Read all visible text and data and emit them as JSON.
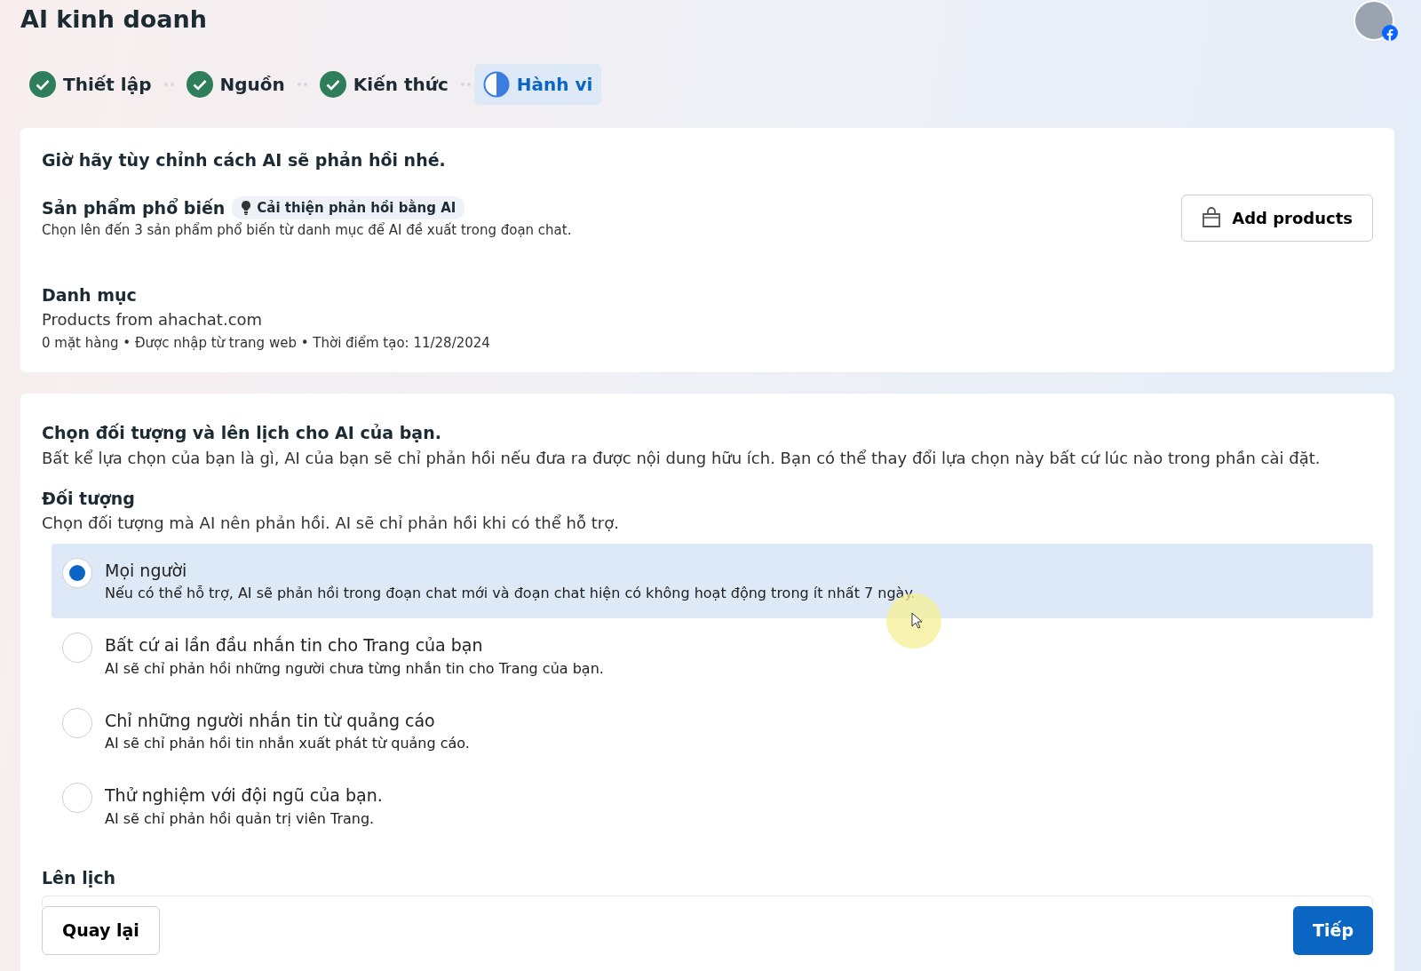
{
  "title": "AI kinh doanh",
  "steps": [
    {
      "label": "Thiết lập",
      "kind": "done",
      "selected": false
    },
    {
      "label": "Nguồn",
      "kind": "done",
      "selected": false
    },
    {
      "label": "Kiến thức",
      "kind": "done",
      "selected": false
    },
    {
      "label": "Hành vi",
      "kind": "current",
      "selected": true
    }
  ],
  "intro_card": {
    "heading": "Giờ hãy tùy chỉnh cách AI sẽ phản hồi nhé.",
    "popular": {
      "title": "Sản phẩm phổ biến",
      "tag": "Cải thiện phản hồi bằng AI",
      "description": "Chọn lên đến 3 sản phẩm phổ biến từ danh mục để AI đề xuất trong đoạn chat.",
      "button": "Add products"
    },
    "catalog": {
      "title": "Danh mục",
      "name": "Products from ahachat.com",
      "meta": "0 mặt hàng • Được nhập từ trang web • Thời điểm tạo: 11/28/2024"
    }
  },
  "audience_card": {
    "heading": "Chọn đối tượng và lên lịch cho AI của bạn.",
    "description": "Bất kể lựa chọn của bạn là gì, AI của bạn sẽ chỉ phản hồi nếu đưa ra được nội dung hữu ích. Bạn có thể thay đổi lựa chọn này bất cứ lúc nào trong phần cài đặt.",
    "audience_title": "Đối tượng",
    "audience_hint": "Chọn đối tượng mà AI nên phản hồi. AI sẽ chỉ phản hồi khi có thể hỗ trợ.",
    "options": [
      {
        "label": "Mọi người",
        "description": "Nếu có thể hỗ trợ, AI sẽ phản hồi trong đoạn chat mới và đoạn chat hiện có không hoạt động trong ít nhất 7 ngày.",
        "selected": true
      },
      {
        "label": "Bất cứ ai lần đầu nhắn tin cho Trang của bạn",
        "description": "AI sẽ chỉ phản hồi những người chưa từng nhắn tin cho Trang của bạn.",
        "selected": false
      },
      {
        "label": "Chỉ những người nhắn tin từ quảng cáo",
        "description": "AI sẽ chỉ phản hồi tin nhắn xuất phát từ quảng cáo.",
        "selected": false
      },
      {
        "label": "Thử nghiệm với đội ngũ của bạn.",
        "description": "AI sẽ chỉ phản hồi quản trị viên Trang.",
        "selected": false
      }
    ],
    "schedule_title": "Lên lịch"
  },
  "footer": {
    "back": "Quay lại",
    "next": "Tiếp"
  }
}
